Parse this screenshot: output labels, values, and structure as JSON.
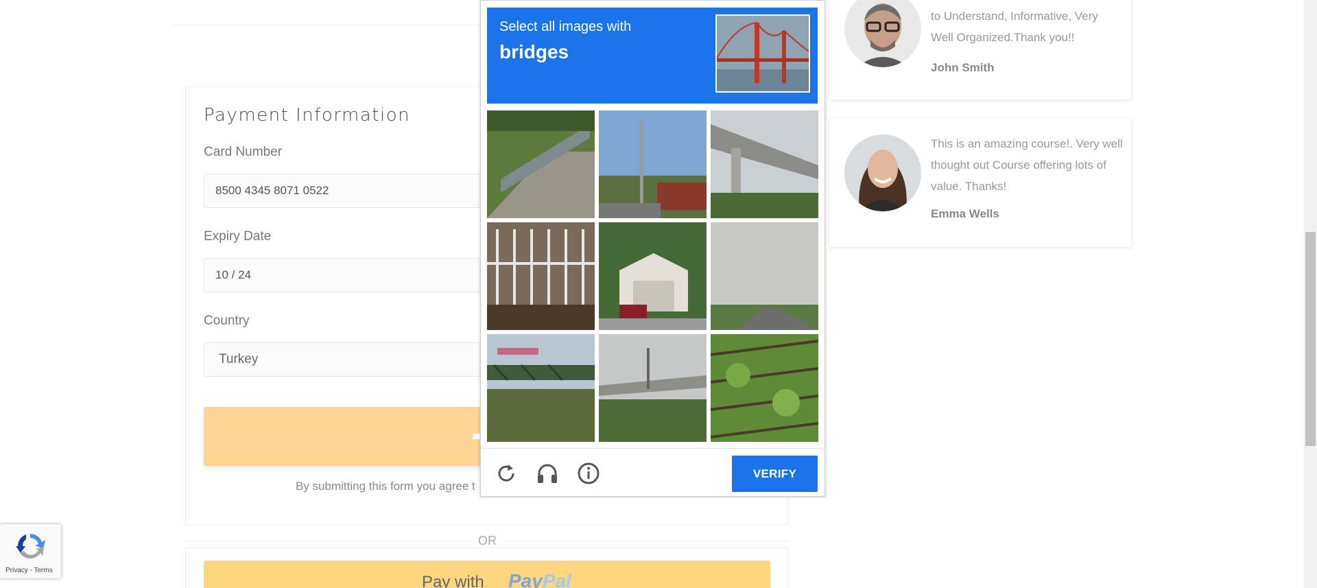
{
  "payment": {
    "title": "Payment Information",
    "card_number_label": "Card Number",
    "card_number_value": "8500 4345 8071 0522",
    "expiry_label": "Expiry Date",
    "expiry_value": "10 / 24",
    "country_label": "Country",
    "country_value": "Turkey",
    "terms_text": "By submitting this form you agree t"
  },
  "or_divider": "OR",
  "paypal": {
    "prefix": "Pay with",
    "logo_pay": "Pay",
    "logo_pal": "Pal"
  },
  "testimonials": [
    {
      "text": "to Understand, Informative, Very Well Organized.Thank you!!",
      "name": "John Smith",
      "avatar_icon": "man-with-glasses-avatar"
    },
    {
      "text": "This is an amazing course!. Very well thought out Course offering lots of value. Thanks!",
      "name": "Emma Wells",
      "avatar_icon": "woman-avatar"
    }
  ],
  "captcha": {
    "prompt": "Select all images with",
    "keyword": "bridges",
    "verify_label": "VERIFY",
    "tiles": [
      {
        "icon": "fence-sidewalk-photo"
      },
      {
        "icon": "street-pole-photo"
      },
      {
        "icon": "overpass-bridge-photo"
      },
      {
        "icon": "metal-gate-photo"
      },
      {
        "icon": "garage-house-photo"
      },
      {
        "icon": "highway-photo"
      },
      {
        "icon": "footbridge-photo"
      },
      {
        "icon": "road-bridge-photo"
      },
      {
        "icon": "vineyard-photo"
      }
    ],
    "controls": [
      "refresh-icon",
      "headphones-icon",
      "info-icon"
    ]
  },
  "recaptcha_badge": {
    "links": "Privacy - Terms"
  },
  "colors": {
    "accent": "#1a73e8",
    "submit": "#ffd596",
    "paypal": "#ffd680"
  }
}
